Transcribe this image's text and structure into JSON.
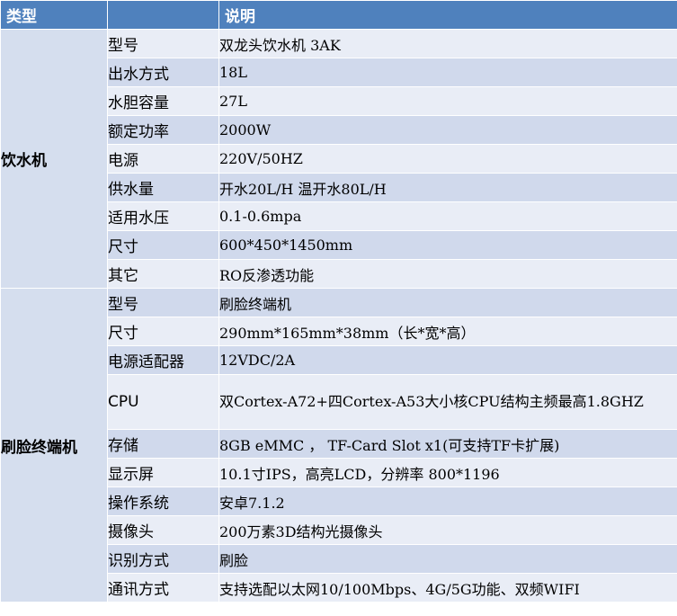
{
  "header": {
    "type": "类型",
    "desc": "说明"
  },
  "groups": [
    {
      "category": "饮水机",
      "rows": [
        {
          "label": "型号",
          "value": "双龙头饮水机  3AK"
        },
        {
          "label": "出水方式",
          "value": "18L"
        },
        {
          "label": "水胆容量",
          "value": "27L"
        },
        {
          "label": "额定功率",
          "value": "2000W"
        },
        {
          "label": "电源",
          "value": "220V/50HZ"
        },
        {
          "label": "供水量",
          "value": "开水20L/H  温开水80L/H"
        },
        {
          "label": "适用水压",
          "value": "0.1-0.6mpa"
        },
        {
          "label": "尺寸",
          "value": "600*450*1450mm"
        },
        {
          "label": "其它",
          "value": "RO反渗透功能"
        }
      ]
    },
    {
      "category": "刷脸终端机",
      "rows": [
        {
          "label": "型号",
          "value": "刷脸终端机"
        },
        {
          "label": "尺寸",
          "value": "290mm*165mm*38mm（长*宽*高）"
        },
        {
          "label": "电源适配器",
          "value": "12VDC/2A"
        },
        {
          "label": "CPU",
          "value": "双Cortex-A72+四Cortex-A53大小核CPU结构主频最高1.8GHZ"
        },
        {
          "label": "存储",
          "value": "8GB eMMC ， TF-Card Slot x1(可支持TF卡扩展)"
        },
        {
          "label": "显示屏",
          "value": "10.1寸IPS，高亮LCD，分辨率  800*1196"
        },
        {
          "label": "操作系统",
          "value": "安卓7.1.2"
        },
        {
          "label": "摄像头",
          "value": "200万素3D结构光摄像头"
        },
        {
          "label": "识别方式",
          "value": "刷脸"
        },
        {
          "label": "通讯方式",
          "value": "支持选配以太网10/100Mbps、4G/5G功能、双频WIFI"
        }
      ]
    }
  ],
  "colors": {
    "header": "#4f81bd",
    "category": "#d5deee",
    "row_odd": "#e9edf6",
    "row_even": "#d0d9ec"
  }
}
